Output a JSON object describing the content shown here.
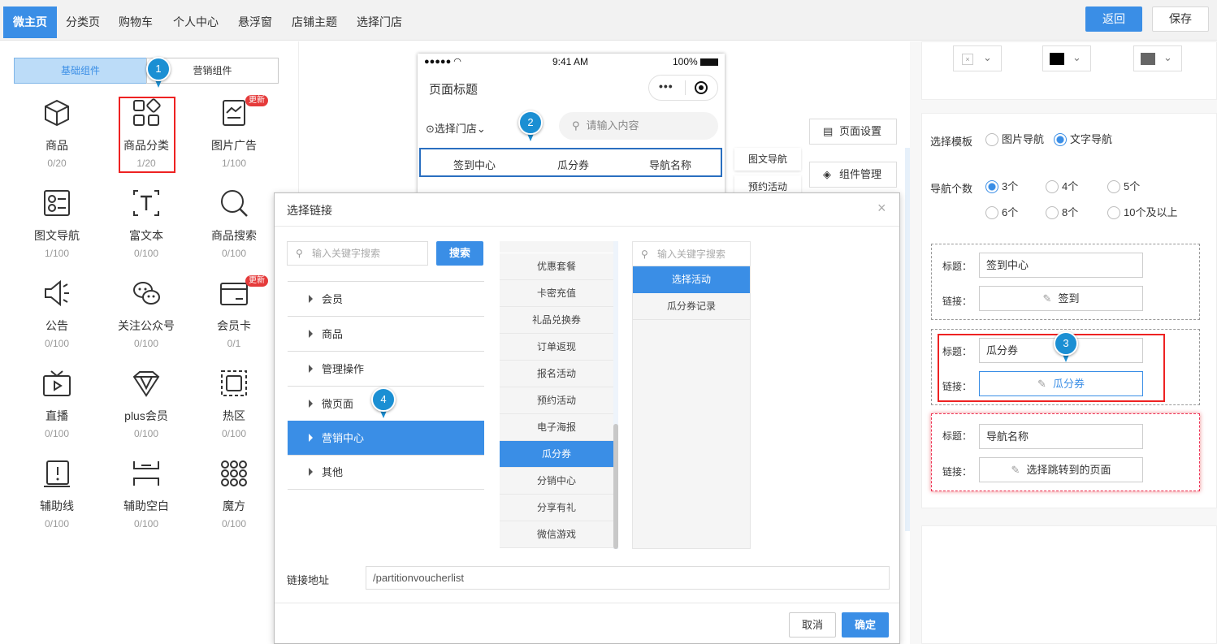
{
  "top_nav": {
    "tabs": [
      "微主页",
      "分类页",
      "购物车",
      "个人中心",
      "悬浮窗",
      "店铺主题",
      "选择门店"
    ],
    "back_label": "返回",
    "save_label": "保存"
  },
  "left_panel": {
    "segments": [
      "基础组件",
      "营销组件"
    ],
    "components": [
      {
        "name": "商品",
        "count": "0/20",
        "icon": "cube-icon"
      },
      {
        "name": "商品分类",
        "count": "1/20",
        "icon": "category-grid-icon"
      },
      {
        "name": "图片广告",
        "count": "1/100",
        "icon": "image-ad-icon",
        "badge": "更新"
      },
      {
        "name": "图文导航",
        "count": "1/100",
        "icon": "image-text-nav-icon"
      },
      {
        "name": "富文本",
        "count": "0/100",
        "icon": "rich-text-icon"
      },
      {
        "name": "商品搜索",
        "count": "0/100",
        "icon": "search-icon"
      },
      {
        "name": "公告",
        "count": "0/100",
        "icon": "speaker-icon"
      },
      {
        "name": "关注公众号",
        "count": "0/100",
        "icon": "wechat-icon"
      },
      {
        "name": "会员卡",
        "count": "0/1",
        "icon": "member-card-icon",
        "badge": "更新"
      },
      {
        "name": "直播",
        "count": "0/100",
        "icon": "tv-icon"
      },
      {
        "name": "plus会员",
        "count": "0/100",
        "icon": "diamond-icon"
      },
      {
        "name": "热区",
        "count": "0/100",
        "icon": "hotspot-icon"
      },
      {
        "name": "辅助线",
        "count": "0/100",
        "icon": "guide-line-icon"
      },
      {
        "name": "辅助空白",
        "count": "0/100",
        "icon": "blank-space-icon"
      },
      {
        "name": "魔方",
        "count": "0/100",
        "icon": "magic-cube-icon"
      }
    ]
  },
  "markers": [
    "1",
    "2",
    "3",
    "4"
  ],
  "phone": {
    "carrier": "●●●●● ",
    "time": "9:41 AM",
    "battery": "100%",
    "page_title": "页面标题",
    "store_select": "选择门店",
    "search_placeholder": "请输入内容",
    "nav_items": [
      "签到中心",
      "瓜分券",
      "导航名称"
    ]
  },
  "side_tags": [
    "图文导航",
    "预约活动"
  ],
  "side_buttons": {
    "page_settings": "页面设置",
    "component_manage": "组件管理"
  },
  "right_panel": {
    "template_label": "选择模板",
    "template_options": [
      "图片导航",
      "文字导航"
    ],
    "count_label": "导航个数",
    "count_options": [
      "3个",
      "4个",
      "5个",
      "6个",
      "8个",
      "10个及以上"
    ],
    "title_label": "标题：",
    "link_label": "链接：",
    "items": [
      {
        "title": "签到中心",
        "link": "签到"
      },
      {
        "title": "瓜分券",
        "link": "瓜分券"
      },
      {
        "title": "导航名称",
        "link": "选择跳转到的页面"
      }
    ],
    "swatch_colors": [
      "#ffffff",
      "#000000",
      "#666666"
    ]
  },
  "dialog": {
    "title": "选择链接",
    "search_placeholder": "输入关键字搜索",
    "search_button": "搜索",
    "tree": [
      "会员",
      "商品",
      "管理操作",
      "微页面",
      "营销中心",
      "其他"
    ],
    "middle_list": [
      "优惠套餐",
      "卡密充值",
      "礼品兑换券",
      "订单返现",
      "报名活动",
      "预约活动",
      "电子海报",
      "瓜分券",
      "分销中心",
      "分享有礼",
      "微信游戏"
    ],
    "right_search_placeholder": "输入关键字搜索",
    "right_list": [
      "选择活动",
      "瓜分券记录"
    ],
    "link_address_label": "链接地址",
    "link_address_value": "/partitionvoucherlist",
    "cancel_label": "取消",
    "confirm_label": "确定"
  }
}
